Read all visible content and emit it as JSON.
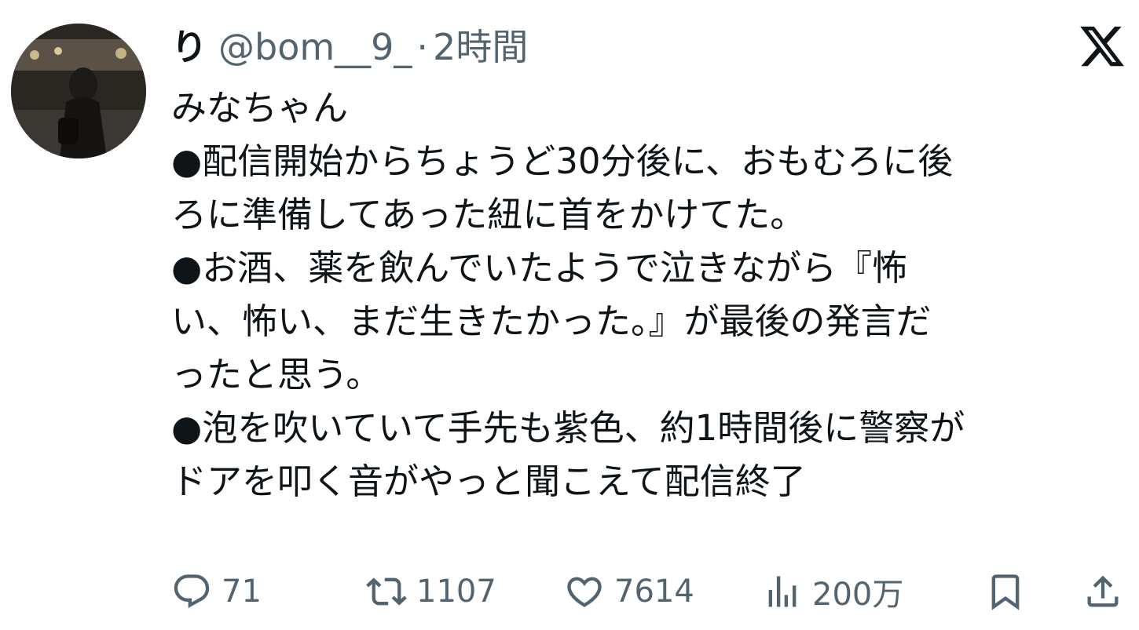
{
  "user": {
    "display_name": "り",
    "handle": "@bom__9_",
    "separator": "·",
    "timestamp": "2時間"
  },
  "platform_logo": "x-logo-icon",
  "tweet": {
    "lines": [
      "みなちゃん",
      "●配信開始からちょうど30分後に、おもむろに後",
      "ろに準備してあった紐に首をかけてた。",
      "●お酒、薬を飲んでいたようで泣きながら『怖",
      "い、怖い、まだ生きたかった。』が最後の発言だ",
      "ったと思う。",
      "●泡を吹いていて手先も紫色、約1時間後に警察が",
      "ドアを叩く音がやっと聞こえて配信終了"
    ]
  },
  "actions": {
    "replies": "71",
    "retweets": "1107",
    "likes": "7614",
    "views": "200万"
  },
  "colors": {
    "text": "#0f1419",
    "secondary": "#536471",
    "background": "#ffffff"
  }
}
